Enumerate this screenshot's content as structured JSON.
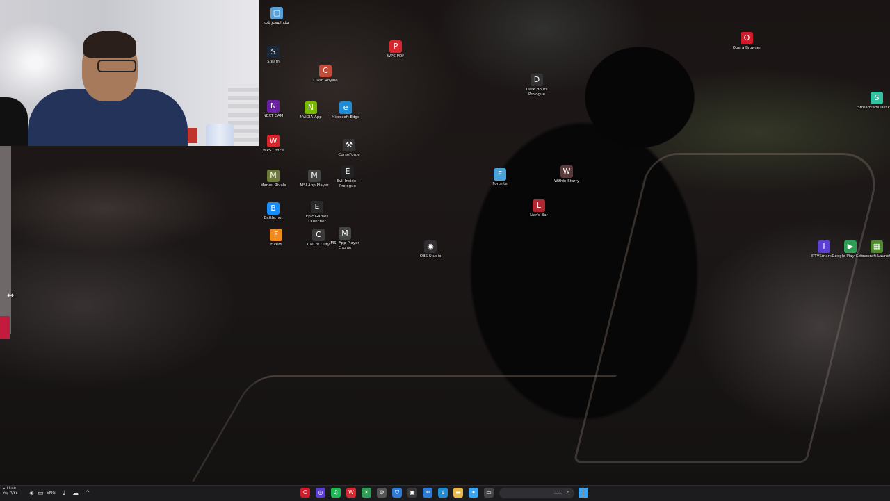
{
  "webcam": {
    "description_label": ""
  },
  "desktop_icons": [
    {
      "id": "arabic-folder",
      "label": "مثلة المحتو ئات",
      "glyph": "▢",
      "color": "#5aa0d8"
    },
    {
      "id": "steam",
      "label": "Steam",
      "glyph": "S",
      "color": "#1b2838"
    },
    {
      "id": "next-cam",
      "label": "NEXT CAM",
      "glyph": "N",
      "color": "#6b1fa3"
    },
    {
      "id": "wps-office",
      "label": "WPS Office",
      "glyph": "W",
      "color": "#d7262c"
    },
    {
      "id": "marvel-rivals",
      "label": "Marvel Rivals",
      "glyph": "M",
      "color": "#6c7a3a"
    },
    {
      "id": "battle-net",
      "label": "Battle.net",
      "glyph": "B",
      "color": "#148eff"
    },
    {
      "id": "fivem",
      "label": "FiveM",
      "glyph": "F",
      "color": "#f28b1f"
    },
    {
      "id": "wps-pdf",
      "label": "WPS PDF",
      "glyph": "P",
      "color": "#d7262c"
    },
    {
      "id": "clash-royale",
      "label": "Clash Royale",
      "glyph": "C",
      "color": "#c44a3a"
    },
    {
      "id": "nvidia-app",
      "label": "NVIDIA App",
      "glyph": "N",
      "color": "#76b900"
    },
    {
      "id": "microsoft-edge",
      "label": "Microsoft Edge",
      "glyph": "e",
      "color": "#1f8dd6"
    },
    {
      "id": "curseforge",
      "label": "CurseForge",
      "glyph": "⚒",
      "color": "#333333"
    },
    {
      "id": "msi-app-player",
      "label": "MSI App Player",
      "glyph": "M",
      "color": "#444444"
    },
    {
      "id": "evil-inside-prologue",
      "label": "Evil Inside - Prologue",
      "glyph": "E",
      "color": "#222222"
    },
    {
      "id": "epic-games-launcher",
      "label": "Epic Games Launcher",
      "glyph": "E",
      "color": "#2a2a2a"
    },
    {
      "id": "call-of-duty",
      "label": "Call of Duty",
      "glyph": "C",
      "color": "#3a3a3a"
    },
    {
      "id": "msi-app-player-engine",
      "label": "MSI App Player Engine",
      "glyph": "M",
      "color": "#444444"
    },
    {
      "id": "obs-studio",
      "label": "OBS Studio",
      "glyph": "◉",
      "color": "#302e31"
    },
    {
      "id": "dark-hours-prologue",
      "label": "Dark Hours Prologue",
      "glyph": "D",
      "color": "#333333"
    },
    {
      "id": "fortnite",
      "label": "Fortnite",
      "glyph": "F",
      "color": "#4aa3d9"
    },
    {
      "id": "within-starry",
      "label": "Within Starry",
      "glyph": "W",
      "color": "#5a3a3a"
    },
    {
      "id": "liars-bar",
      "label": "Liar's Bar",
      "glyph": "L",
      "color": "#b0272f"
    },
    {
      "id": "opera-browser",
      "label": "Opera Browser",
      "glyph": "O",
      "color": "#d11a2a"
    },
    {
      "id": "streamlabs-desktop",
      "label": "Streamlabs Desktop",
      "glyph": "S",
      "color": "#31c3a2"
    },
    {
      "id": "iptv-smarters",
      "label": "IPTVSmarte...",
      "glyph": "I",
      "color": "#5b3fd1"
    },
    {
      "id": "google-play-games",
      "label": "Google Play Games",
      "glyph": "▶",
      "color": "#2f9e55"
    },
    {
      "id": "minecraft-launcher",
      "label": "Minecraft Launcher",
      "glyph": "▦",
      "color": "#4f8a2c"
    }
  ],
  "taskbar": {
    "clock_line1": "١١:٤٥ م",
    "clock_line2": "٢٥/٠٦/٢٥",
    "language": "ENG",
    "search_placeholder": "بحث",
    "search_glyph": "⌕",
    "tray_chevron": "^",
    "apps": [
      {
        "id": "opera",
        "glyph": "O",
        "color": "#d11a2a"
      },
      {
        "id": "browser",
        "glyph": "◎",
        "color": "#5b3fd1"
      },
      {
        "id": "spotify",
        "glyph": "♫",
        "color": "#1db954"
      },
      {
        "id": "wps",
        "glyph": "W",
        "color": "#d7262c"
      },
      {
        "id": "xbox",
        "glyph": "✕",
        "color": "#2f9e55"
      },
      {
        "id": "settings",
        "glyph": "⚙",
        "color": "#555555"
      },
      {
        "id": "defender",
        "glyph": "⛉",
        "color": "#2f7bd6"
      },
      {
        "id": "store",
        "glyph": "▣",
        "color": "#3a3a3a"
      },
      {
        "id": "mail",
        "glyph": "✉",
        "color": "#2f7bd6"
      },
      {
        "id": "edge",
        "glyph": "e",
        "color": "#1f8dd6"
      },
      {
        "id": "explorer",
        "glyph": "▬",
        "color": "#e8b84a"
      },
      {
        "id": "copilot",
        "glyph": "✦",
        "color": "#3aa4f0"
      },
      {
        "id": "taskview",
        "glyph": "▭",
        "color": "#444444"
      }
    ]
  },
  "colors": {
    "accent": "#3aa4f0",
    "left_red": "#c21b3e"
  }
}
